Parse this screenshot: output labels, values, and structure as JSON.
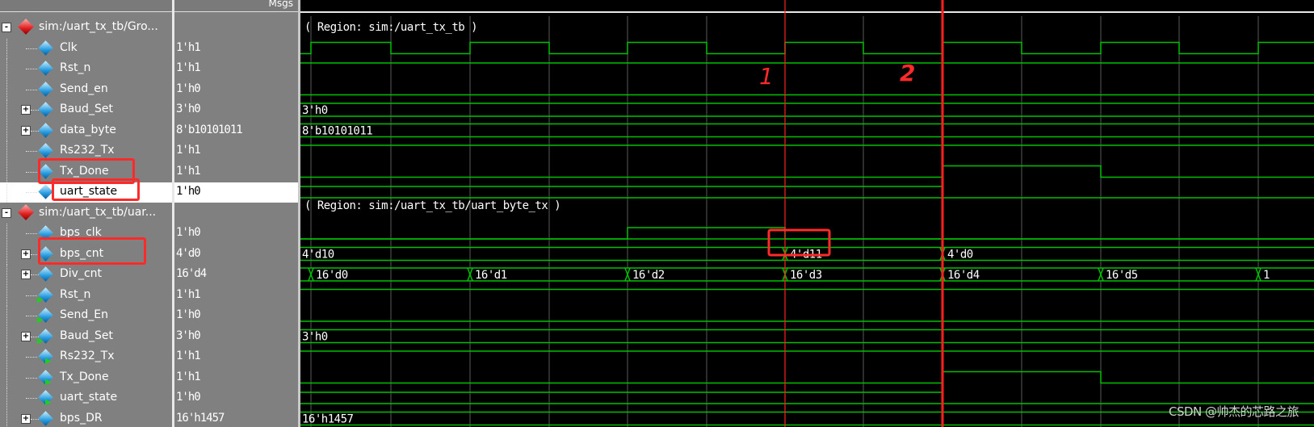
{
  "header": {
    "names_label": "",
    "msgs_label": "Msgs"
  },
  "signals": [
    {
      "name": "sim:/uart_tx_tb/Gro...",
      "value": "",
      "type": "group",
      "level": 0,
      "expand": "-"
    },
    {
      "name": "Clk",
      "value": "1'h1",
      "type": "sig",
      "level": 1
    },
    {
      "name": "Rst_n",
      "value": "1'h1",
      "type": "sig",
      "level": 1
    },
    {
      "name": "Send_en",
      "value": "1'h0",
      "type": "sig",
      "level": 1
    },
    {
      "name": "Baud_Set",
      "value": "3'h0",
      "type": "sig",
      "level": 1,
      "expand": "+"
    },
    {
      "name": "data_byte",
      "value": "8'b10101011",
      "type": "sig",
      "level": 1,
      "expand": "+"
    },
    {
      "name": "Rs232_Tx",
      "value": "1'h1",
      "type": "sig",
      "level": 1
    },
    {
      "name": "Tx_Done",
      "value": "1'h1",
      "type": "sig",
      "level": 1
    },
    {
      "name": "uart_state",
      "value": "1'h0",
      "type": "sig",
      "level": 1,
      "selected": true
    },
    {
      "name": "sim:/uart_tx_tb/uar...",
      "value": "",
      "type": "group",
      "level": 0,
      "expand": "-"
    },
    {
      "name": "bps_clk",
      "value": "1'h0",
      "type": "sig",
      "level": 1
    },
    {
      "name": "bps_cnt",
      "value": "4'd0",
      "type": "sig",
      "level": 1,
      "expand": "+"
    },
    {
      "name": "Div_cnt",
      "value": "16'd4",
      "type": "sig",
      "level": 1,
      "expand": "+"
    },
    {
      "name": "Rst_n",
      "value": "1'h1",
      "type": "in",
      "level": 1
    },
    {
      "name": "Send_En",
      "value": "1'h0",
      "type": "in",
      "level": 1
    },
    {
      "name": "Baud_Set",
      "value": "3'h0",
      "type": "in",
      "level": 1,
      "expand": "+"
    },
    {
      "name": "Rs232_Tx",
      "value": "1'h1",
      "type": "out",
      "level": 1
    },
    {
      "name": "Tx_Done",
      "value": "1'h1",
      "type": "out",
      "level": 1
    },
    {
      "name": "uart_state",
      "value": "1'h0",
      "type": "out",
      "level": 1
    },
    {
      "name": "bps_DR",
      "value": "16'h1457",
      "type": "sig",
      "level": 1,
      "expand": "+"
    }
  ],
  "region_labels": [
    "( Region: sim:/uart_tx_tb )",
    "( Region: sim:/uart_tx_tb/uart_byte_tx )"
  ],
  "bus_labels": {
    "baud_set": "3'h0",
    "data_byte": "8'b10101011",
    "bps_cnt": [
      "4'd10",
      "4'd11",
      "4'd0"
    ],
    "div_cnt": [
      "16'd0",
      "16'd1",
      "16'd2",
      "16'd3",
      "16'd4",
      "16'd5",
      "1"
    ],
    "baud_set2": "3'h0",
    "bps_dr": "16'h1457"
  },
  "annotations": {
    "marker_1": "1",
    "marker_2": "2"
  },
  "watermark": "CSDN @帅杰的芯路之旅",
  "colors": {
    "wave": "#00c000",
    "grid": "#5a5a5a",
    "cursor": "#ff2020",
    "highlight": "#ff2a2a"
  }
}
